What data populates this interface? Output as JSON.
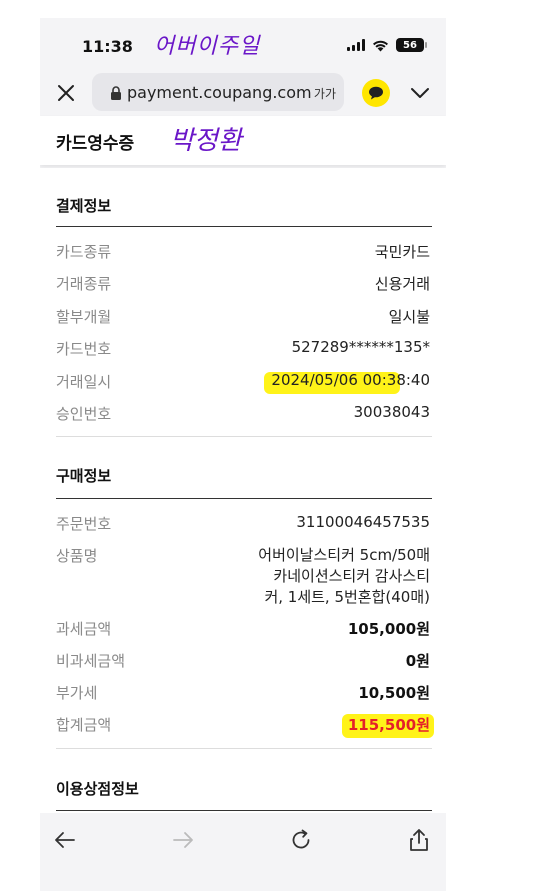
{
  "status_bar": {
    "time": "11:38",
    "annotation": "어버이주일",
    "battery": "56"
  },
  "browser": {
    "url": "payment.coupang.com",
    "text_size_label": "가가"
  },
  "header": {
    "title": "카드영수증",
    "annotation": "박정환"
  },
  "payment_info": {
    "title": "결제정보",
    "rows": [
      {
        "label": "카드종류",
        "value": "국민카드"
      },
      {
        "label": "거래종류",
        "value": "신용거래"
      },
      {
        "label": "할부개월",
        "value": "일시불"
      },
      {
        "label": "카드번호",
        "value": "527289******135*"
      },
      {
        "label": "거래일시",
        "value": "2024/05/06 00:38:40"
      },
      {
        "label": "승인번호",
        "value": "30038043"
      }
    ]
  },
  "purchase_info": {
    "title": "구매정보",
    "rows": [
      {
        "label": "주문번호",
        "value": "31100046457535"
      },
      {
        "label": "상품명",
        "lines": [
          "어버이날스티커 5cm/50매",
          "카네이션스티커 감사스티",
          "커, 1세트, 5번혼합(40매)"
        ]
      },
      {
        "label": "과세금액",
        "value": "105,000원"
      },
      {
        "label": "비과세금액",
        "value": "0원"
      },
      {
        "label": "부가세",
        "value": "10,500원"
      },
      {
        "label": "합계금액",
        "value": "115,500원"
      }
    ]
  },
  "merchant_info": {
    "title": "이용상점정보"
  },
  "colors": {
    "accent_total": "#e4202a",
    "highlight": "#fff200",
    "annotation_ink": "#6a16c8",
    "kakao": "#ffe600"
  }
}
